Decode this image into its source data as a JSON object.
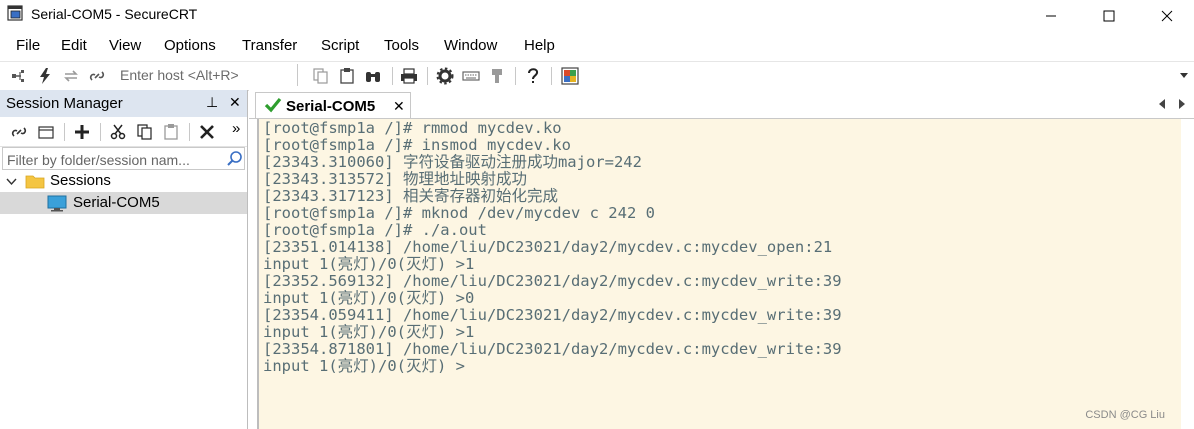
{
  "window": {
    "title": "Serial-COM5 - SecureCRT",
    "minimize": "─",
    "maximize": "☐",
    "close": "✕"
  },
  "menu": [
    {
      "label": "File"
    },
    {
      "label": "Edit"
    },
    {
      "label": "View"
    },
    {
      "label": "Options"
    },
    {
      "label": "Transfer"
    },
    {
      "label": "Script"
    },
    {
      "label": "Tools"
    },
    {
      "label": "Window"
    },
    {
      "label": "Help"
    }
  ],
  "toolbar": {
    "host_placeholder": "Enter host <Alt+R>"
  },
  "session_manager": {
    "title": "Session Manager",
    "pin": "⊥",
    "close": "✕",
    "more": "»",
    "filter_placeholder": "Filter by folder/session nam...",
    "tree": {
      "folder": "Sessions",
      "session": "Serial-COM5"
    }
  },
  "tab": {
    "label": "Serial-COM5",
    "close": "✕"
  },
  "terminal": {
    "lines": [
      "[root@fsmp1a /]# rmmod mycdev.ko",
      "[root@fsmp1a /]# insmod mycdev.ko",
      "[23343.310060] 字符设备驱动注册成功major=242",
      "[23343.313572] 物理地址映射成功",
      "[23343.317123] 相关寄存器初始化完成",
      "[root@fsmp1a /]# mknod /dev/mycdev c 242 0",
      "[root@fsmp1a /]# ./a.out",
      "[23351.014138] /home/liu/DC23021/day2/mycdev.c:mycdev_open:21",
      "input 1(亮灯)/0(灭灯) >1",
      "[23352.569132] /home/liu/DC23021/day2/mycdev.c:mycdev_write:39",
      "input 1(亮灯)/0(灭灯) >0",
      "[23354.059411] /home/liu/DC23021/day2/mycdev.c:mycdev_write:39",
      "input 1(亮灯)/0(灭灯) >1",
      "[23354.871801] /home/liu/DC23021/day2/mycdev.c:mycdev_write:39",
      "input 1(亮灯)/0(灭灯) >"
    ],
    "watermark": "CSDN @CG Liu"
  },
  "colors": {
    "terminal_bg": "#fdf6e3",
    "terminal_fg": "#586e75",
    "session_header_bg": "#dde5f0",
    "selected_row_bg": "#d9d9d9",
    "check_green": "#2e9e2e"
  }
}
